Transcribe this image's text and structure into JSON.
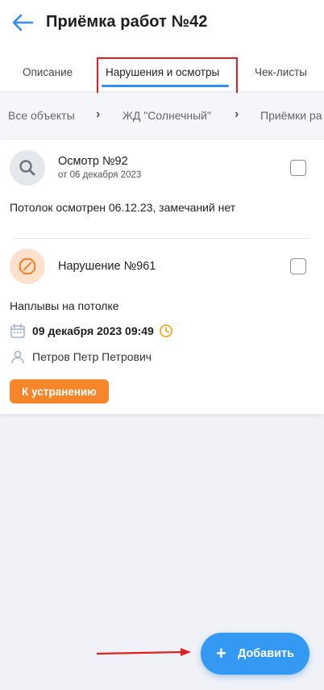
{
  "header": {
    "title": "Приёмка работ №42",
    "back_icon": "arrow-left-icon"
  },
  "tabs": [
    {
      "label": "Описание"
    },
    {
      "label": "Нарушения и осмотры",
      "active": true
    },
    {
      "label": "Чек-листы"
    }
  ],
  "breadcrumbs": [
    {
      "label": "Все объекты"
    },
    {
      "label": "ЖД \"Солнечный\""
    },
    {
      "label": "Приёмки ра"
    }
  ],
  "breadcrumb_separator": "›",
  "items": [
    {
      "icon": "magnifier-icon",
      "title": "Осмотр №92",
      "subtitle": "от 06 декабря 2023",
      "description": "Потолок осмотрен 06.12.23, замечаний нет",
      "checked": false
    },
    {
      "icon": "violation-octagon-icon",
      "title": "Нарушение №961",
      "description": "Наплывы на потолке",
      "date": "09 декабря 2023 09:49",
      "person": "Петров Петр Петрович",
      "action_label": "К устранению",
      "checked": false
    }
  ],
  "fab": {
    "plus": "+",
    "label": "Добавить"
  },
  "colors": {
    "accent_blue": "#3399f3",
    "action_orange": "#f7862b",
    "annotation_red": "#e02020"
  }
}
